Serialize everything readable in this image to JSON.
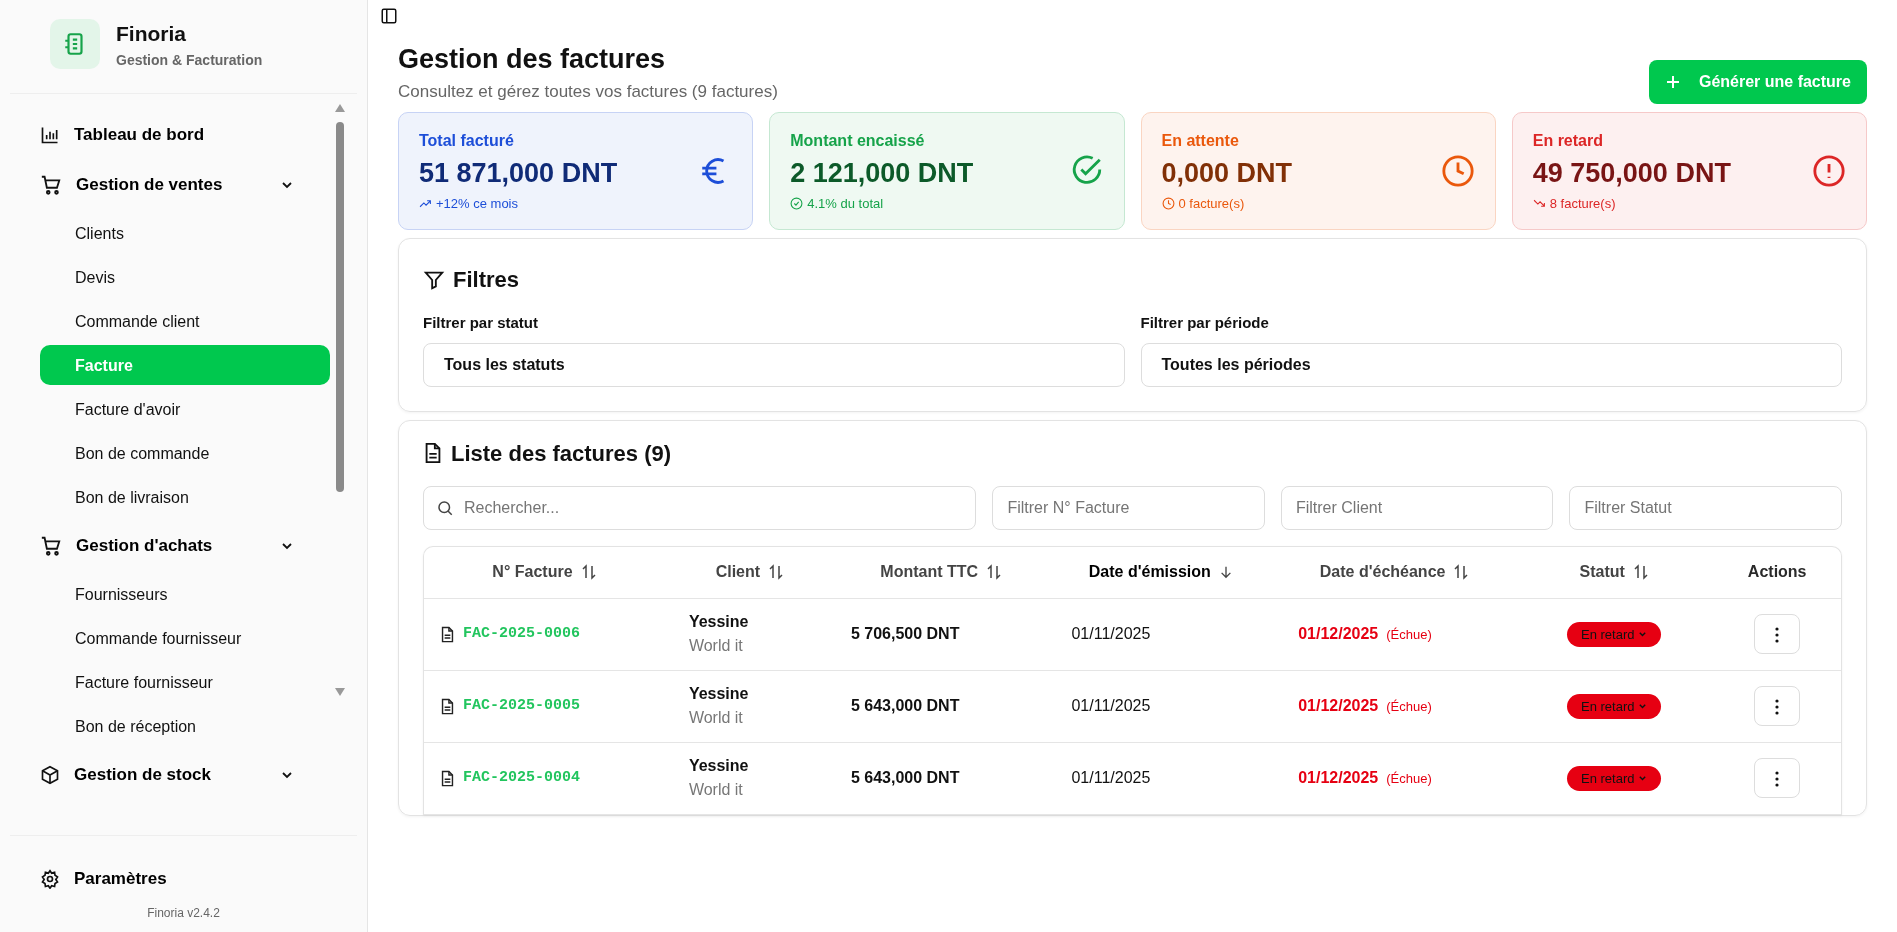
{
  "brand": {
    "name": "Finoria",
    "tagline": "Gestion & Facturation"
  },
  "sidebar": {
    "items": [
      {
        "label": "Tableau de bord",
        "kind": "link"
      },
      {
        "label": "Gestion de ventes",
        "kind": "group",
        "expanded": true,
        "children": [
          {
            "label": "Clients",
            "selected": false
          },
          {
            "label": "Devis",
            "selected": false
          },
          {
            "label": "Commande client",
            "selected": false
          },
          {
            "label": "Facture",
            "selected": true
          },
          {
            "label": "Facture d'avoir",
            "selected": false
          },
          {
            "label": "Bon de commande",
            "selected": false
          },
          {
            "label": "Bon de livraison",
            "selected": false
          }
        ]
      },
      {
        "label": "Gestion d'achats",
        "kind": "group",
        "expanded": true,
        "children": [
          {
            "label": "Fournisseurs",
            "selected": false
          },
          {
            "label": "Commande fournisseur",
            "selected": false
          },
          {
            "label": "Facture fournisseur",
            "selected": false
          },
          {
            "label": "Bon de réception",
            "selected": false
          }
        ]
      },
      {
        "label": "Gestion de stock",
        "kind": "group",
        "expanded": true
      }
    ],
    "settings": "Paramètres",
    "version": "Finoria v2.4.2"
  },
  "page": {
    "title": "Gestion des factures",
    "subtitle": "Consultez et gérez toutes vos factures (9 factures)",
    "action": "Générer une facture"
  },
  "stats": [
    {
      "label": "Total facturé",
      "value": "51 871,000 DNT",
      "note": "+12% ce mois",
      "color": "#1d4ed8"
    },
    {
      "label": "Montant encaissé",
      "value": "2 121,000 DNT",
      "note": "4.1% du total",
      "color": "#16a34a"
    },
    {
      "label": "En attente",
      "value": "0,000 DNT",
      "note": "0 facture(s)",
      "color": "#ea580c"
    },
    {
      "label": "En retard",
      "value": "49 750,000 DNT",
      "note": "8 facture(s)",
      "color": "#dc2626"
    }
  ],
  "filters": {
    "title": "Filtres",
    "fields": [
      {
        "label": "Filtrer par statut",
        "value": "Tous les statuts"
      },
      {
        "label": "Filtrer par période",
        "value": "Toutes les périodes"
      }
    ]
  },
  "list": {
    "title": "Liste des factures (9)",
    "search": {
      "placeholder": "Rechercher..."
    },
    "column_filters": [
      {
        "placeholder": "Filtrer N° Facture"
      },
      {
        "placeholder": "Filtrer Client"
      },
      {
        "placeholder": "Filtrer Statut"
      }
    ]
  },
  "table": {
    "columns": [
      {
        "label": "N° Facture",
        "sortable": true,
        "sorted": false
      },
      {
        "label": "Client",
        "sortable": true,
        "sorted": false
      },
      {
        "label": "Montant TTC",
        "sortable": true,
        "sorted": false
      },
      {
        "label": "Date d'émission",
        "sortable": true,
        "sorted": true
      },
      {
        "label": "Date d'échéance",
        "sortable": true,
        "sorted": false
      },
      {
        "label": "Statut",
        "sortable": true,
        "sorted": false
      },
      {
        "label": "Actions",
        "sortable": false,
        "sorted": false
      }
    ],
    "rows": [
      {
        "number": "FAC-2025-0006",
        "client": "Yessine",
        "company": "World it",
        "amount": "5 706,500 DNT",
        "issued": "01/11/2025",
        "due": "01/12/2025",
        "overdue": true,
        "overdue_label": "(Échue)",
        "status": {
          "label": "En retard",
          "color": "#e60012"
        }
      },
      {
        "number": "FAC-2025-0005",
        "client": "Yessine",
        "company": "World it",
        "amount": "5 643,000 DNT",
        "issued": "01/11/2025",
        "due": "01/12/2025",
        "overdue": true,
        "overdue_label": "(Échue)",
        "status": {
          "label": "En retard",
          "color": "#e60012"
        }
      },
      {
        "number": "FAC-2025-0004",
        "client": "Yessine",
        "company": "World it",
        "amount": "5 643,000 DNT",
        "issued": "01/11/2025",
        "due": "01/12/2025",
        "overdue": true,
        "overdue_label": "(Échue)",
        "status": {
          "label": "En retard",
          "color": "#e60012"
        }
      }
    ]
  }
}
